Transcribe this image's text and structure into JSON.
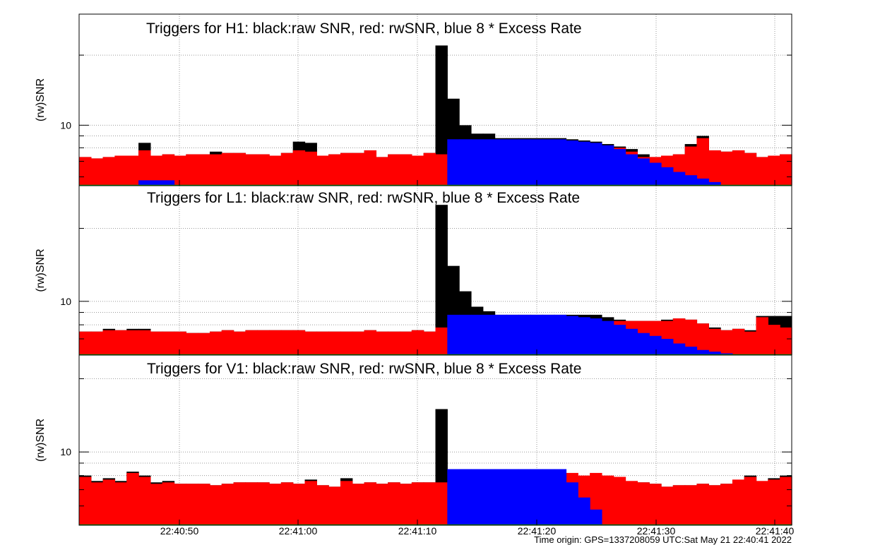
{
  "chart_data": [
    {
      "type": "bar",
      "title": "Triggers for H1: black:raw SNR, red: rwSNR, blue 8 * Excess Rate",
      "ylabel": "(rw)SNR",
      "yscale": "log",
      "ylim": [
        5.5,
        30
      ],
      "y_ticks": [
        10
      ],
      "grid": true,
      "legend": "none",
      "series": [
        {
          "role": "raw",
          "color": "#000000",
          "values": [
            7.3,
            7.2,
            7.3,
            7.4,
            7.4,
            8.4,
            7.4,
            7.5,
            7.4,
            7.5,
            7.5,
            7.7,
            7.6,
            7.6,
            7.5,
            7.5,
            7.4,
            7.6,
            8.5,
            8.4,
            7.4,
            7.5,
            7.6,
            7.6,
            7.8,
            7.3,
            7.5,
            7.5,
            7.4,
            7.6,
            22.0,
            13.0,
            10.0,
            9.2,
            9.2,
            8.8,
            8.8,
            8.8,
            8.8,
            8.8,
            8.8,
            8.7,
            8.6,
            8.5,
            8.3,
            8.1,
            7.9,
            7.5,
            7.3,
            7.4,
            7.5,
            8.3,
            9.0,
            7.8,
            7.7,
            7.8,
            7.6,
            7.3,
            7.4,
            7.5
          ]
        },
        {
          "role": "rwsnr",
          "color": "#ff0000",
          "values": [
            7.3,
            7.2,
            7.3,
            7.4,
            7.4,
            7.8,
            7.4,
            7.5,
            7.4,
            7.5,
            7.5,
            7.5,
            7.6,
            7.6,
            7.5,
            7.5,
            7.4,
            7.6,
            7.8,
            7.7,
            7.4,
            7.5,
            7.6,
            7.6,
            7.8,
            7.3,
            7.5,
            7.5,
            7.4,
            7.6,
            7.5,
            7.8,
            7.8,
            7.8,
            7.8,
            7.8,
            7.8,
            7.8,
            7.8,
            7.8,
            7.8,
            7.8,
            7.8,
            7.8,
            7.8,
            8.0,
            7.7,
            7.3,
            7.3,
            7.4,
            7.5,
            8.1,
            8.8,
            7.8,
            7.7,
            7.8,
            7.6,
            7.3,
            7.4,
            7.5
          ]
        },
        {
          "role": "excess_rate",
          "color": "#0000ff",
          "values": [
            0,
            0,
            0,
            0,
            0,
            5.8,
            5.8,
            5.8,
            0,
            0,
            0,
            0,
            0,
            0,
            0,
            0,
            0,
            0,
            0,
            0,
            0,
            0,
            0,
            0,
            0,
            0,
            0,
            0,
            0,
            0,
            0,
            8.7,
            8.7,
            8.7,
            8.7,
            8.7,
            8.7,
            8.7,
            8.7,
            8.7,
            8.7,
            8.6,
            8.5,
            8.4,
            8.2,
            7.9,
            7.5,
            7.2,
            6.9,
            6.6,
            6.3,
            6.1,
            5.9,
            5.7,
            0,
            0,
            0,
            0,
            0,
            0
          ]
        }
      ]
    },
    {
      "type": "bar",
      "title": "Triggers for L1: black:raw SNR, red: rwSNR, blue 8 * Excess Rate",
      "ylabel": "(rw)SNR",
      "yscale": "log",
      "ylim": [
        6.0,
        30
      ],
      "y_ticks": [
        10
      ],
      "grid": true,
      "legend": "none",
      "series": [
        {
          "role": "raw",
          "color": "#000000",
          "values": [
            7.5,
            7.5,
            7.7,
            7.6,
            7.7,
            7.7,
            7.5,
            7.5,
            7.5,
            7.4,
            7.4,
            7.5,
            7.6,
            7.5,
            7.6,
            7.6,
            7.6,
            7.6,
            7.6,
            7.5,
            7.5,
            7.5,
            7.5,
            7.5,
            7.6,
            7.5,
            7.5,
            7.5,
            7.6,
            7.5,
            25.0,
            14.0,
            11.0,
            9.5,
            9.1,
            8.8,
            8.8,
            8.8,
            8.8,
            8.8,
            8.8,
            8.8,
            8.8,
            8.8,
            8.6,
            8.4,
            8.3,
            8.3,
            8.3,
            8.4,
            8.5,
            8.4,
            8.1,
            7.8,
            7.6,
            7.7,
            7.6,
            8.7,
            8.7,
            8.7
          ]
        },
        {
          "role": "rwsnr",
          "color": "#ff0000",
          "values": [
            7.5,
            7.5,
            7.6,
            7.6,
            7.6,
            7.6,
            7.5,
            7.5,
            7.5,
            7.4,
            7.4,
            7.5,
            7.6,
            7.5,
            7.6,
            7.6,
            7.6,
            7.6,
            7.6,
            7.5,
            7.5,
            7.5,
            7.5,
            7.5,
            7.6,
            7.5,
            7.5,
            7.5,
            7.6,
            7.5,
            7.8,
            7.8,
            7.8,
            7.8,
            7.8,
            7.8,
            7.8,
            7.8,
            7.8,
            7.8,
            7.8,
            7.8,
            7.8,
            7.9,
            8.1,
            8.3,
            8.3,
            8.3,
            8.3,
            8.3,
            8.5,
            8.4,
            8.1,
            7.7,
            7.6,
            7.7,
            7.5,
            8.6,
            8.0,
            7.8
          ]
        },
        {
          "role": "excess_rate",
          "color": "#0000ff",
          "values": [
            0,
            0,
            0,
            0,
            0,
            0,
            0,
            0,
            0,
            0,
            0,
            0,
            0,
            0,
            0,
            0,
            0,
            0,
            0,
            0,
            0,
            0,
            0,
            0,
            0,
            0,
            0,
            0,
            0,
            0,
            0,
            8.8,
            8.8,
            8.8,
            8.8,
            8.8,
            8.8,
            8.8,
            8.8,
            8.8,
            8.8,
            8.7,
            8.6,
            8.5,
            8.3,
            8.0,
            7.7,
            7.4,
            7.2,
            7.0,
            6.7,
            6.5,
            6.3,
            6.2,
            6.1,
            6.0,
            0,
            0,
            0,
            0
          ]
        }
      ]
    },
    {
      "type": "bar",
      "title": "Triggers for V1: black:raw SNR, red: rwSNR, blue 8 * Excess Rate",
      "ylabel": "(rw)SNR",
      "yscale": "log",
      "ylim": [
        5.0,
        25
      ],
      "y_ticks": [
        10
      ],
      "grid": true,
      "legend": "none",
      "series": [
        {
          "role": "raw",
          "color": "#000000",
          "values": [
            8.0,
            7.6,
            7.8,
            7.6,
            8.3,
            8.0,
            7.5,
            7.6,
            7.4,
            7.4,
            7.4,
            7.3,
            7.4,
            7.5,
            7.5,
            7.5,
            7.4,
            7.5,
            7.4,
            7.7,
            7.3,
            7.2,
            7.8,
            7.4,
            7.5,
            7.4,
            7.5,
            7.4,
            7.5,
            7.5,
            15.0,
            7.5,
            7.5,
            7.5,
            7.5,
            7.5,
            7.5,
            7.5,
            7.5,
            7.5,
            7.5,
            7.5,
            7.5,
            7.5,
            7.5,
            7.5,
            7.5,
            7.5,
            7.4,
            7.2,
            7.3,
            7.3,
            7.4,
            7.3,
            7.4,
            7.4,
            8.0,
            7.5,
            7.8,
            8.0
          ]
        },
        {
          "role": "rwsnr",
          "color": "#ff0000",
          "values": [
            7.9,
            7.5,
            7.7,
            7.5,
            8.2,
            7.9,
            7.4,
            7.5,
            7.4,
            7.4,
            7.4,
            7.3,
            7.4,
            7.5,
            7.5,
            7.5,
            7.4,
            7.5,
            7.4,
            7.6,
            7.3,
            7.2,
            7.6,
            7.4,
            7.5,
            7.4,
            7.5,
            7.4,
            7.5,
            7.5,
            7.5,
            7.5,
            7.5,
            7.5,
            7.5,
            7.5,
            7.5,
            7.5,
            7.5,
            7.5,
            7.5,
            8.2,
            8.0,
            8.2,
            8.0,
            7.9,
            7.6,
            7.5,
            7.4,
            7.2,
            7.3,
            7.3,
            7.4,
            7.3,
            7.4,
            7.7,
            7.9,
            7.6,
            7.7,
            7.9
          ]
        },
        {
          "role": "excess_rate",
          "color": "#0000ff",
          "values": [
            0,
            0,
            0,
            0,
            0,
            0,
            0,
            0,
            0,
            0,
            0,
            0,
            0,
            0,
            0,
            0,
            0,
            0,
            0,
            0,
            0,
            0,
            0,
            0,
            0,
            0,
            0,
            0,
            0,
            0,
            0,
            8.5,
            8.5,
            8.5,
            8.5,
            8.5,
            8.5,
            8.5,
            8.5,
            8.5,
            8.5,
            7.5,
            6.5,
            5.8,
            0,
            0,
            0,
            0,
            0,
            0,
            0,
            0,
            0,
            0,
            0,
            0,
            0,
            0,
            0,
            0
          ]
        }
      ]
    }
  ],
  "x_axis": {
    "type": "time",
    "range": [
      "22:40:41",
      "22:41:41"
    ],
    "tick_labels": [
      "22:40:50",
      "22:41:00",
      "22:41:10",
      "22:41:20",
      "22:41:30",
      "22:41:40"
    ]
  },
  "footer": "Time origin: GPS=1337208059 UTC:Sat May 21 22:40:41 2022"
}
